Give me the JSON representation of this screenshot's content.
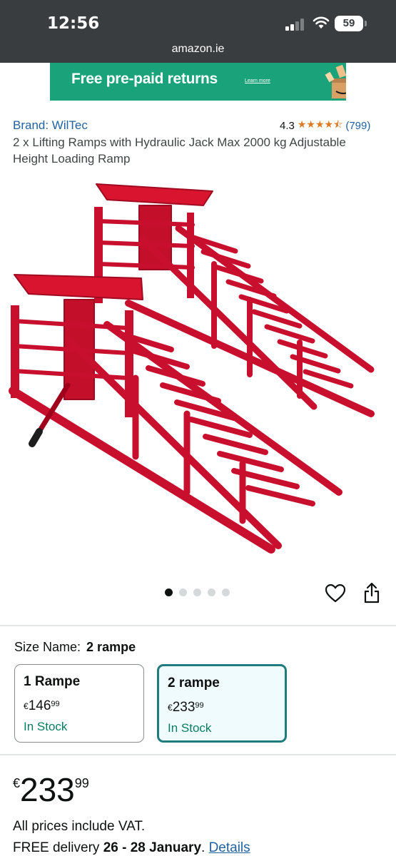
{
  "status_bar": {
    "time": "12:56",
    "battery": "59",
    "url": "amazon.ie"
  },
  "banner": {
    "text": "Free pre-paid returns",
    "link": "Learn more",
    "color": "#1aa37a"
  },
  "product": {
    "brand": "Brand: WilTec",
    "rating": "4.3",
    "stars": "★★★★⯪",
    "rating_count": "(799)",
    "title": "2 x Lifting Ramps with Hydraulic Jack Max 2000 kg Adjustable Height Loading Ramp"
  },
  "carousel": {
    "dots": 5,
    "active_index": 0
  },
  "size": {
    "label": "Size Name:",
    "selected": "2 rampe",
    "options": [
      {
        "name": "1 Rampe",
        "currency": "€",
        "whole": "146",
        "fraction": "99",
        "stock": "In Stock",
        "selected": false
      },
      {
        "name": "2 rampe",
        "currency": "€",
        "whole": "233",
        "fraction": "99",
        "stock": "In Stock",
        "selected": true
      }
    ]
  },
  "price": {
    "currency": "€",
    "whole": "233",
    "fraction": "99"
  },
  "vat": "All prices include VAT.",
  "delivery": {
    "prefix": "FREE delivery",
    "dates": "26 - 28 January",
    "suffix": ".",
    "link": "Details"
  },
  "colors": {
    "accent": "#1f7b7d",
    "link": "#2162a1",
    "stock": "#067d62",
    "star": "#de7921",
    "ramp": "#c8102e"
  }
}
